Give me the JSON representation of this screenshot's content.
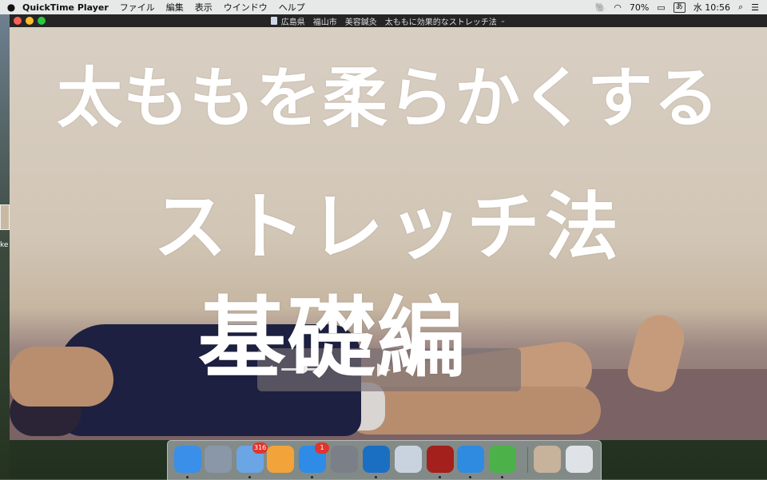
{
  "menubar": {
    "apple_icon": "apple-icon",
    "app_name": "QuickTime Player",
    "menus": [
      "ファイル",
      "編集",
      "表示",
      "ウインドウ",
      "ヘルプ"
    ],
    "battery": "70%",
    "ime": "あ",
    "clock": "水 10:56"
  },
  "window": {
    "title": "広島県　福山市　美容鍼灸　太ももに効果的なストレッチ法"
  },
  "video": {
    "captions": [
      "太ももを柔らかくする",
      "ストレッチ法",
      "基礎編"
    ]
  },
  "dock": {
    "apps": [
      {
        "name": "Finder",
        "icon": "finder-icon",
        "color": "#3a8fe8",
        "running": true
      },
      {
        "name": "Launchpad",
        "icon": "rocket-icon",
        "color": "#8a97a8",
        "running": false
      },
      {
        "name": "Mail",
        "icon": "mail-icon",
        "color": "#6aa5e6",
        "badge": "316",
        "running": true
      },
      {
        "name": "Pages",
        "icon": "pages-icon",
        "color": "#f2a33a",
        "running": false
      },
      {
        "name": "App Store",
        "icon": "appstore-icon",
        "color": "#2e8be6",
        "badge": "1",
        "running": true
      },
      {
        "name": "System Preferences",
        "icon": "gear-icon",
        "color": "#7a7f88",
        "running": false
      },
      {
        "name": "QuickTime Player",
        "icon": "quicktime-icon",
        "color": "#1b6fc2",
        "running": true
      },
      {
        "name": "Preview",
        "icon": "preview-icon",
        "color": "#c9d3df",
        "running": false
      },
      {
        "name": "Acrobat",
        "icon": "acrobat-icon",
        "color": "#a3201c",
        "running": true
      },
      {
        "name": "Safari",
        "icon": "safari-icon",
        "color": "#2f8be0",
        "running": true
      },
      {
        "name": "Evernote",
        "icon": "evernote-icon",
        "color": "#4cb148",
        "running": true
      },
      {
        "name": "Video thumbnail",
        "icon": "video-thumbnail-icon",
        "color": "#c7b29b",
        "running": false
      },
      {
        "name": "Trash",
        "icon": "trash-icon",
        "color": "#dfe3e8",
        "running": false
      }
    ]
  }
}
